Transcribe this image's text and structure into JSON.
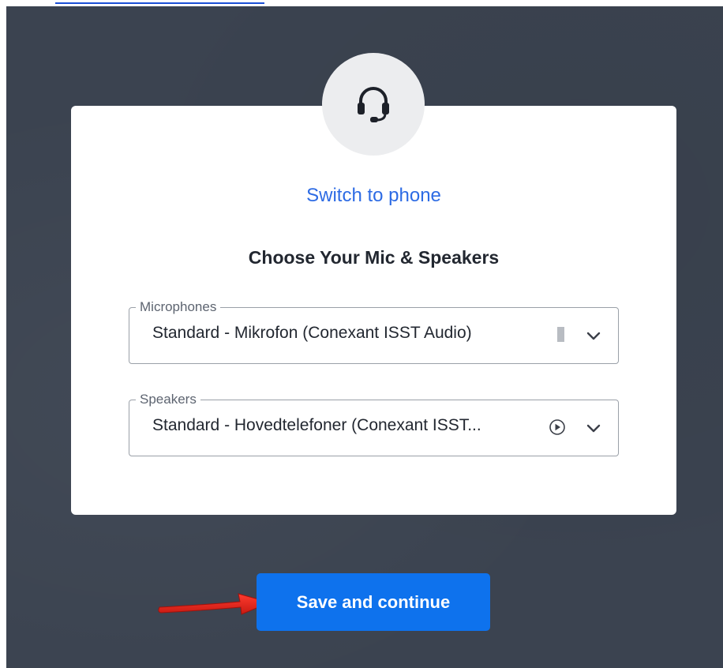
{
  "link": {
    "text": ""
  },
  "audio_setup": {
    "icon": "headset-icon",
    "switch_link": "Switch to phone",
    "title": "Choose Your Mic & Speakers",
    "microphones": {
      "label": "Microphones",
      "selected": "Standard - Mikrofon (Conexant ISST Audio)",
      "level_icon": "mic-level-icon",
      "dropdown_icon": "chevron-down-icon"
    },
    "speakers": {
      "label": "Speakers",
      "selected": "Standard - Hovedtelefoner (Conexant ISST...",
      "test_icon": "play-circle-icon",
      "dropdown_icon": "chevron-down-icon"
    }
  },
  "actions": {
    "save_label": "Save and continue"
  },
  "annotation": {
    "arrow_icon": "red-arrow-icon"
  },
  "colors": {
    "background": "#3b4350",
    "card": "#ffffff",
    "link": "#2d6be4",
    "primary_button": "#0e72ed",
    "annotation_arrow": "#e0231b"
  }
}
